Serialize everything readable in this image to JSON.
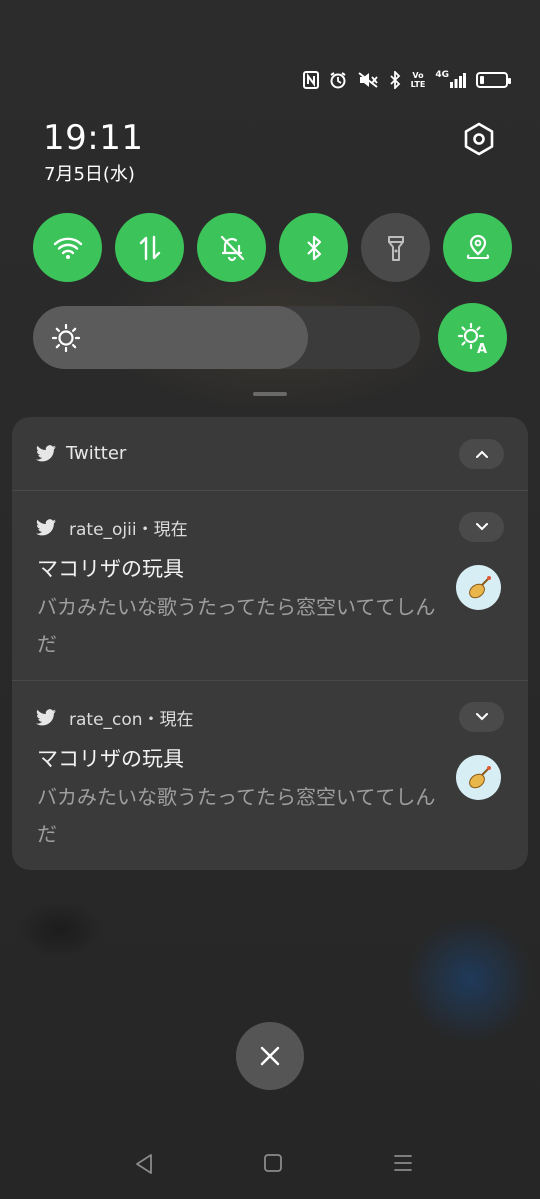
{
  "status_bar": {
    "icons": [
      "nfc-icon",
      "alarm-icon",
      "mute-icon",
      "bluetooth-icon",
      "volte-icon",
      "4g-signal-icon",
      "battery-icon"
    ],
    "volte": "Vo\nLTE",
    "network": "4G",
    "battery_level": 0.3
  },
  "header": {
    "time": "19:11",
    "date": "7月5日(水)"
  },
  "quick_settings": {
    "tiles": [
      {
        "icon": "wifi-icon",
        "on": true
      },
      {
        "icon": "mobile-data-icon",
        "on": true
      },
      {
        "icon": "do-not-disturb-icon",
        "on": true
      },
      {
        "icon": "bluetooth-icon",
        "on": true
      },
      {
        "icon": "flashlight-icon",
        "on": false
      },
      {
        "icon": "location-icon",
        "on": true
      }
    ],
    "brightness_level": 0.71,
    "auto_brightness_label": "A"
  },
  "colors": {
    "accent": "#3cc35a",
    "tile_off": "#4a4a4a",
    "card": "#3a3a3a"
  },
  "notification_group": {
    "app_name": "Twitter",
    "notifications": [
      {
        "meta": "rate_ojii・現在",
        "title": "マコリザの玩具",
        "body": "バカみたいな歌うたってたら窓空いててしんだ"
      },
      {
        "meta": "rate_con・現在",
        "title": "マコリザの玩具",
        "body": "バカみたいな歌うたってたら窓空いててしんだ"
      }
    ]
  },
  "nav_bar": {
    "buttons": [
      "back-icon",
      "home-icon",
      "recents-icon"
    ]
  }
}
